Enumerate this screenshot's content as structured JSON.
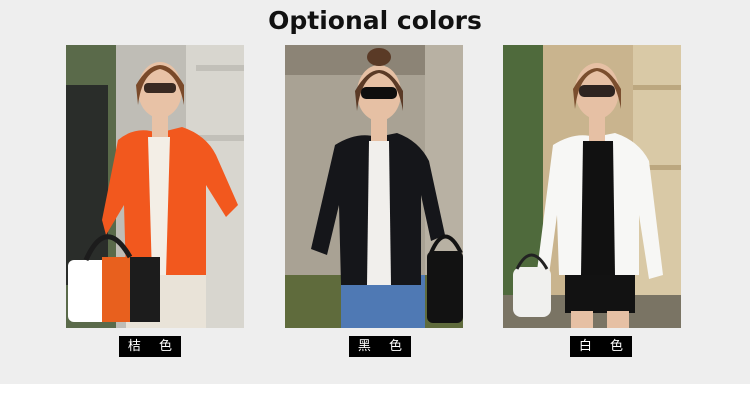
{
  "heading": "Optional colors",
  "variants": [
    {
      "label": "桔 色",
      "color_hex": "#f2581e",
      "model_icon": "orange-jacket-model"
    },
    {
      "label": "黑 色",
      "color_hex": "#15161a",
      "model_icon": "black-jacket-model"
    },
    {
      "label": "白 色",
      "color_hex": "#f7f7f5",
      "model_icon": "white-jacket-model"
    }
  ]
}
